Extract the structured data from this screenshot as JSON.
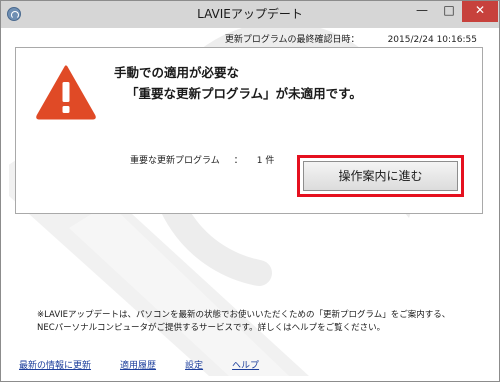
{
  "window": {
    "title": "LAVIEアップデート",
    "controls": {
      "minimize": "—",
      "maximize": "□",
      "close": "✕"
    }
  },
  "last_check": {
    "label": "更新プログラムの最終確認日時：",
    "value": "2015/2/24 10:16:55"
  },
  "alert": {
    "icon": "warning-icon",
    "line1": "手動での適用が必要な",
    "line2": "「重要な更新プログラム」が未適用です。",
    "count_label": "重要な更新プログラム",
    "count_sep": "：",
    "count_value": "1 件",
    "proceed_button": "操作案内に進む"
  },
  "note": {
    "line1": "※LAVIEアップデートは、パソコンを最新の状態でお使いいただくための「更新プログラム」をご案内する、",
    "line2": "NECパーソナルコンピュータがご提供するサービスです。詳しくはヘルプをご覧ください。"
  },
  "footer_links": {
    "update": "最新の情報に更新",
    "history": "適用履歴",
    "settings": "設定",
    "help": "ヘルプ"
  },
  "colors": {
    "warning": "#e04a26",
    "highlight_frame": "#e5101f",
    "link": "#1d3f9c",
    "close_button": "#c7413c"
  }
}
